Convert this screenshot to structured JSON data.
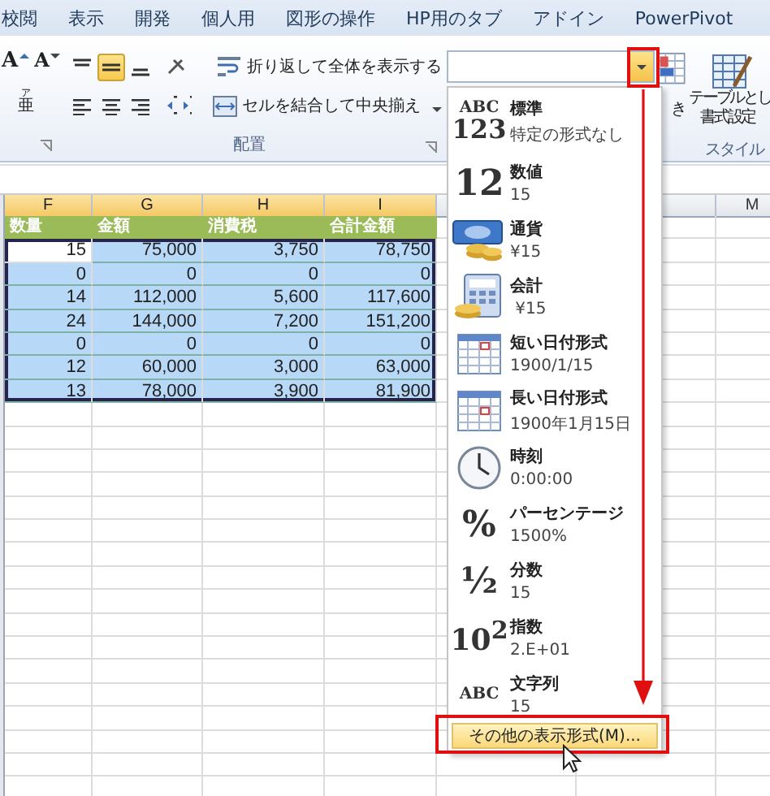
{
  "ribbon_tabs": [
    "校閲",
    "表示",
    "開発",
    "個人用",
    "図形の操作",
    "HP用のタブ",
    "アドイン",
    "PowerPivot"
  ],
  "font_group": {
    "grow_font": "A",
    "shrink_font": "A",
    "phonetic": "亜",
    "phonetic_ruby": "ア"
  },
  "alignment_group": {
    "label": "配置",
    "vertical_align": [
      {
        "kind": "top",
        "selected": false
      },
      {
        "kind": "middle",
        "selected": true
      },
      {
        "kind": "bottom",
        "selected": false
      }
    ],
    "horizontal_align": [
      {
        "kind": "left",
        "selected": false
      },
      {
        "kind": "center",
        "selected": false
      },
      {
        "kind": "right",
        "selected": false
      }
    ],
    "wrap_text": "折り返して全体を表示する",
    "merge_center": "セルを結合して中央揃え"
  },
  "styles_group": {
    "conditional_format": "き",
    "format_as_table": [
      "テーブルとし",
      "書式設定"
    ],
    "label": "スタイル"
  },
  "sheet": {
    "columns_left": [
      {
        "label": "F",
        "selected": true
      },
      {
        "label": "G",
        "selected": true
      },
      {
        "label": "H",
        "selected": true
      },
      {
        "label": "I",
        "selected": true
      }
    ],
    "columns_right": [
      {
        "label": "M",
        "selected": false
      }
    ],
    "header_row": [
      "数量",
      "金額",
      "消費税",
      "合計金額"
    ],
    "rows": [
      {
        "selected": true,
        "cells": [
          {
            "text": "15",
            "active": true
          },
          {
            "text": "75,000",
            "active": false
          },
          {
            "text": "3,750",
            "active": false
          },
          {
            "text": "78,750",
            "active": false
          }
        ]
      },
      {
        "selected": true,
        "cells": [
          {
            "text": "0",
            "active": false
          },
          {
            "text": "0",
            "active": false
          },
          {
            "text": "0",
            "active": false
          },
          {
            "text": "0",
            "active": false
          }
        ]
      },
      {
        "selected": true,
        "cells": [
          {
            "text": "14",
            "active": false
          },
          {
            "text": "112,000",
            "active": false
          },
          {
            "text": "5,600",
            "active": false
          },
          {
            "text": "117,600",
            "active": false
          }
        ]
      },
      {
        "selected": true,
        "cells": [
          {
            "text": "24",
            "active": false
          },
          {
            "text": "144,000",
            "active": false
          },
          {
            "text": "7,200",
            "active": false
          },
          {
            "text": "151,200",
            "active": false
          }
        ]
      },
      {
        "selected": true,
        "cells": [
          {
            "text": "0",
            "active": false
          },
          {
            "text": "0",
            "active": false
          },
          {
            "text": "0",
            "active": false
          },
          {
            "text": "0",
            "active": false
          }
        ]
      },
      {
        "selected": true,
        "cells": [
          {
            "text": "12",
            "active": false
          },
          {
            "text": "60,000",
            "active": false
          },
          {
            "text": "3,000",
            "active": false
          },
          {
            "text": "63,000",
            "active": false
          }
        ]
      },
      {
        "selected": true,
        "cells": [
          {
            "text": "13",
            "active": false
          },
          {
            "text": "78,000",
            "active": false
          },
          {
            "text": "3,900",
            "active": false
          },
          {
            "text": "81,900",
            "active": false
          }
        ]
      }
    ]
  },
  "format_menu": {
    "items": [
      {
        "kind": "general",
        "icon_lines": [
          "ABC",
          "123"
        ],
        "title": "標準",
        "sample": "特定の形式なし"
      },
      {
        "kind": "number",
        "icon_lines": [
          "12"
        ],
        "title": "数値",
        "sample": "15"
      },
      {
        "kind": "currency",
        "title": "通貨",
        "sample": "¥15"
      },
      {
        "kind": "accounting",
        "title": "会計",
        "sample": " ¥15"
      },
      {
        "kind": "short_date",
        "title": "短い日付形式",
        "sample": "1900/1/15"
      },
      {
        "kind": "long_date",
        "title": "長い日付形式",
        "sample": "1900年1月15日"
      },
      {
        "kind": "time",
        "title": "時刻",
        "sample": "0:00:00"
      },
      {
        "kind": "percent",
        "icon_lines": [
          "%"
        ],
        "title": "パーセンテージ",
        "sample": "1500%"
      },
      {
        "kind": "fraction",
        "icon_lines": [
          "½"
        ],
        "title": "分数",
        "sample": "15"
      },
      {
        "kind": "scientific",
        "icon_lines": [
          "10$^{2}$"
        ],
        "title": "指数",
        "sample": "2.E+01"
      },
      {
        "kind": "text",
        "icon_lines": [
          "ABC"
        ],
        "title": "文字列",
        "sample": "15"
      }
    ],
    "more_button": "その他の表示形式(M)..."
  }
}
